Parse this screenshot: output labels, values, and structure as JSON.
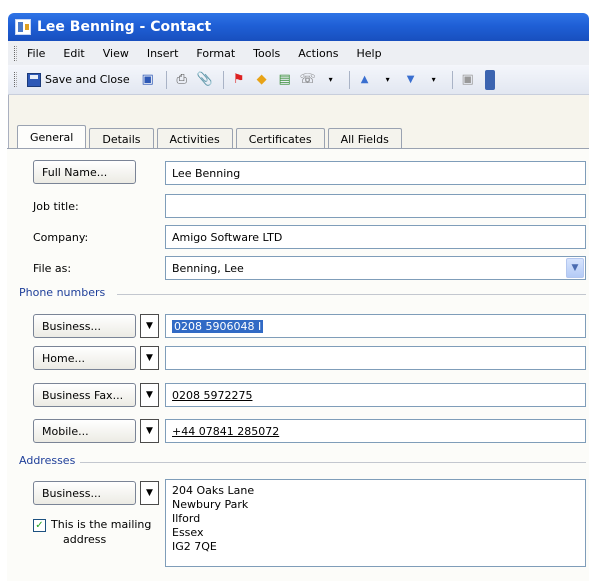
{
  "window": {
    "title": "Lee Benning - Contact"
  },
  "menu": [
    "File",
    "Edit",
    "View",
    "Insert",
    "Format",
    "Tools",
    "Actions",
    "Help"
  ],
  "toolbar": {
    "save_close_label": "Save and Close",
    "icons": [
      "save-icon",
      "print-icon",
      "attach-icon",
      "flag-icon",
      "categories-icon",
      "address-card-icon",
      "call-icon",
      "previous-item-icon",
      "next-item-icon",
      "map-icon",
      "overflow-icon"
    ]
  },
  "tabs": [
    {
      "label": "General",
      "active": true
    },
    {
      "label": "Details",
      "active": false
    },
    {
      "label": "Activities",
      "active": false
    },
    {
      "label": "Certificates",
      "active": false
    },
    {
      "label": "All Fields",
      "active": false
    }
  ],
  "general": {
    "full_name_button": "Full Name...",
    "full_name_value": "Lee Benning",
    "job_title_label": "Job title:",
    "job_title_value": "",
    "company_label": "Company:",
    "company_value": "Amigo Software LTD",
    "file_as_label": "File as:",
    "file_as_value": "Benning, Lee"
  },
  "phones": {
    "section_title": "Phone numbers",
    "rows": [
      {
        "type": "Business...",
        "value": "0208 5906048 I",
        "selected": true
      },
      {
        "type": "Home...",
        "value": ""
      },
      {
        "type": "Business Fax...",
        "value": "0208 5972275"
      },
      {
        "type": "Mobile...",
        "value": "+44 07841 285072"
      }
    ]
  },
  "addresses": {
    "section_title": "Addresses",
    "type": "Business...",
    "mailing_label_line1": "This is the mailing",
    "mailing_label_line2": "address",
    "mailing_checked": true,
    "lines": [
      "204 Oaks Lane",
      "Newbury Park",
      "Ilford",
      "Essex",
      "IG2 7QE"
    ]
  },
  "colors": {
    "titlebar": "#1f5fd6",
    "selection": "#316ac5",
    "section_title": "#1f3f9a"
  }
}
